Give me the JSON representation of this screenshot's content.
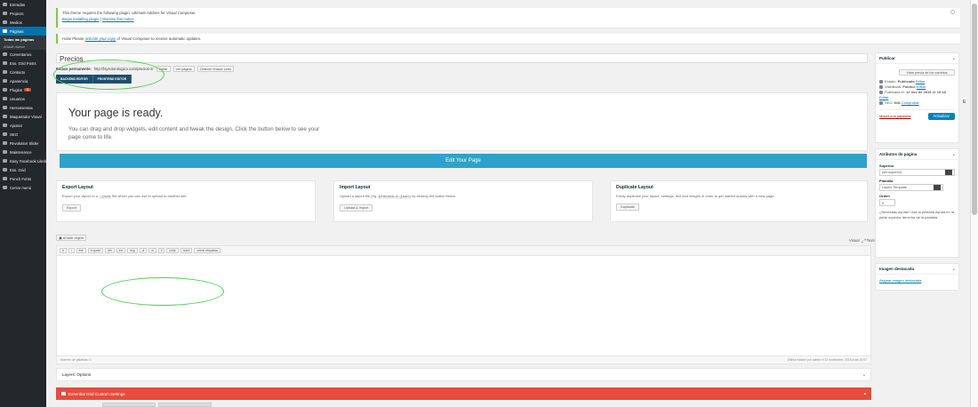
{
  "sidebar": {
    "items": [
      {
        "label": "Entradas",
        "icon": "pin-icon"
      },
      {
        "label": "Projects",
        "icon": "projects-icon"
      },
      {
        "label": "Medios",
        "icon": "media-icon"
      },
      {
        "label": "Páginas",
        "icon": "pages-icon",
        "active": true
      }
    ],
    "subitems": [
      "Todas las páginas",
      "Añadir nueva"
    ],
    "items2": [
      {
        "label": "Comentarios",
        "icon": "comments-icon"
      },
      {
        "label": "Ess. Grid Posts",
        "icon": "grid-icon"
      },
      {
        "label": "Contacto",
        "icon": "mail-icon"
      },
      {
        "label": "Apariencia",
        "icon": "brush-icon"
      },
      {
        "label": "Plugins",
        "icon": "plugin-icon",
        "badge": "11"
      },
      {
        "label": "Usuarios",
        "icon": "users-icon"
      },
      {
        "label": "Herramientas",
        "icon": "tools-icon"
      },
      {
        "label": "Maquetador Visual",
        "icon": "visual-composer-icon"
      },
      {
        "label": "Ajustes",
        "icon": "settings-icon"
      },
      {
        "label": "SEO",
        "icon": "seo-icon"
      },
      {
        "label": "Revolution Slider",
        "icon": "revolution-icon"
      },
      {
        "label": "Maintenance",
        "icon": "maintenance-icon"
      },
      {
        "label": "Easy Facebook Likebox",
        "icon": "facebook-icon"
      },
      {
        "label": "Ess. Grid",
        "icon": "grid-icon"
      },
      {
        "label": "Punch Fonts",
        "icon": "fonts-icon"
      },
      {
        "label": "Cerrar menú",
        "icon": "collapse-icon"
      }
    ]
  },
  "notices": {
    "plugin_text_prefix": "This theme requires the following plugin:",
    "plugin_name": "Ultimate Addons for Visual Composer.",
    "begin_install": "Begin installing plugin",
    "separator": "|",
    "dismiss": "Dismiss this notice",
    "vc_prefix": "Hola! Please",
    "vc_link": "activate your copy",
    "vc_suffix": "of Visual Composer to receive automatic updates."
  },
  "post": {
    "title": "Precios",
    "permalink_label": "Enlace permanente:",
    "permalink_url": "http://lsysotorologico.com/precios-2/",
    "edit_btn": "Editar",
    "view_btn": "Ver página",
    "shortlink_btn": "Obtener enlace corto"
  },
  "editor_switch": {
    "backend": "BACKEND EDITOR",
    "frontend": "FRONTEND EDITOR"
  },
  "ready": {
    "title": "Your page is ready.",
    "body": "You can drag and drop widgets, edit content and tweak the design. Click the button below to see your page come to life."
  },
  "edit_page_btn": "Edit Your Page",
  "panels": [
    {
      "title": "Export Layout",
      "desc_pre": "Export your layout to a",
      "code": ".json",
      "desc_post": "file which you can use to upload to another site.",
      "button": "Export"
    },
    {
      "title": "Import Layout",
      "desc_pre": "Upload a layout file (eg.",
      "code": "precios-1.json",
      "desc_post": ") by clicking the button below.",
      "button": "Upload & Import"
    },
    {
      "title": "Duplicate Layout",
      "desc_pre": "Easily duplicate your layout, settings, text and images in order to get started quickly with a new page.",
      "code": "",
      "desc_post": "",
      "button": "Duplicate"
    }
  ],
  "media_btn": "Añadir objeto",
  "editor_tabs": {
    "visual": "Visual",
    "text": "Texto"
  },
  "quicktags": [
    "b",
    "i",
    "link",
    "b-quote",
    "del",
    "ins",
    "img",
    "ul",
    "ol",
    "li",
    "code",
    "more",
    "cerrar etiquetas"
  ],
  "statusbar": {
    "word_count": "Número de palabras: 0",
    "last_edit": "Última edición por admin el 12 noviembre, 2015 a las 10:07"
  },
  "layers_options": "Layers: Options",
  "eg_settings": "Essential Grid Custom Settings",
  "publish": {
    "title": "Publicar",
    "preview_btn": "Vista previa de los cambios",
    "status_label": "Estado:",
    "status_value": "Publicada",
    "visibility_label": "Visibilidad:",
    "visibility_value": "Público",
    "published_label": "Publicada el:",
    "published_value": "12 nov de 2015 @ 10:18",
    "edit": "Editar",
    "seo_label": "SEO:",
    "seo_value": "N/A",
    "seo_link": "Comprobar",
    "trash": "Mover a la papelera",
    "update": "Actualizar"
  },
  "attributes": {
    "title": "Atributos de página",
    "parent_label": "Superior",
    "parent_value": "(sin superior)",
    "template_label": "Plantilla",
    "template_value": "Layers Template",
    "order_label": "Orden",
    "order_value": "0",
    "help": "¿Necesitas ayuda? Usa la pestaña Ayuda en la parte superior derecha de la pantalla."
  },
  "featured": {
    "title": "Imagen destacada",
    "link": "Asignar imagen destacada"
  },
  "colors": {
    "sidebar": "#23282d",
    "accent": "#0073aa",
    "edit_btn": "#2ea2cc",
    "eg_bar": "#e74c3c",
    "highlight": "#4ad24a"
  }
}
